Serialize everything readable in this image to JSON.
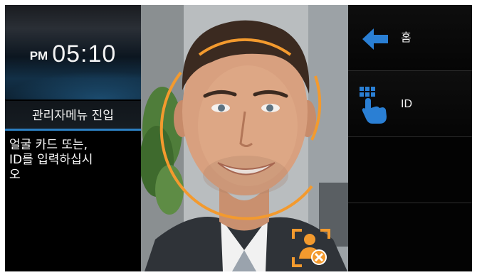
{
  "clock": {
    "ampm": "PM",
    "time": "05:10"
  },
  "admin_menu": {
    "label": "관리자메뉴 진입"
  },
  "instruction": {
    "lines": [
      "얼굴 카드 또는,",
      "ID를 입력하십시",
      "오"
    ]
  },
  "side_menu": {
    "home_label": "홈",
    "id_label": "ID"
  },
  "colors": {
    "accent_blue": "#2a7fd4",
    "face_guide_orange": "#f39a2e",
    "menu_underline": "#2c7fc1"
  },
  "icons": {
    "home": "arrow-left-icon",
    "id": "keypad-hand-icon",
    "face_status": "face-cancel-icon"
  }
}
